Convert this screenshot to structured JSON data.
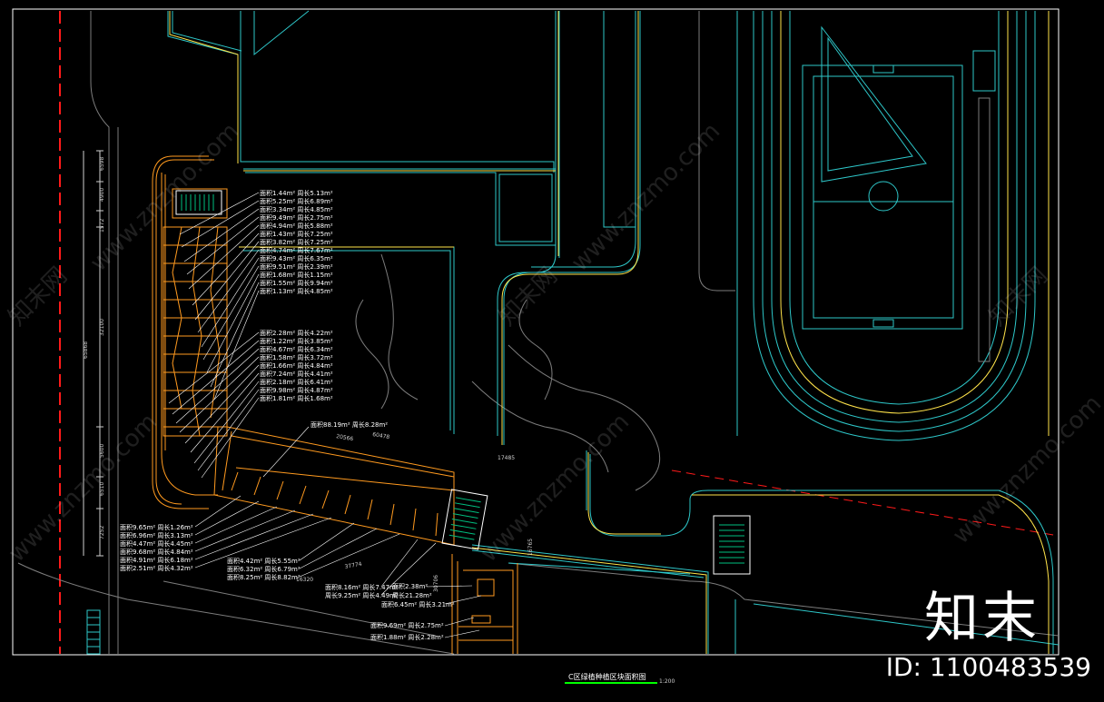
{
  "drawing": {
    "title": "C区绿植种植区块面积图",
    "scale": "1:200"
  },
  "labels_group_a": [
    "面积1.44m² 周长5.13m²",
    "面积5.25m² 周长6.89m²",
    "面积3.34m² 周长4.85m²",
    "面积9.49m² 周长2.75m²",
    "面积4.94m² 周长5.88m²",
    "面积1.43m² 周长7.25m²",
    "面积3.82m² 周长7.25m²",
    "面积4.74m² 周长7.67m²",
    "面积9.43m² 周长6.35m²",
    "面积9.51m² 周长2.39m²",
    "面积1.68m² 周长1.15m²",
    "面积1.55m² 周长9.94m²",
    "面积1.13m² 周长4.85m²"
  ],
  "labels_group_b": [
    "面积2.28m² 周长4.22m²",
    "面积1.22m² 周长3.85m²",
    "面积4.67m² 周长6.34m²",
    "面积1.58m² 周长3.72m²",
    "面积1.66m² 周长4.84m²",
    "面积7.24m² 周长4.41m²",
    "面积2.18m² 周长6.41m²",
    "面积9.98m² 周长4.87m²",
    "面积1.81m² 周长1.68m²"
  ],
  "label_main": "面积88.19m² 周长8.28m²",
  "labels_group_c": [
    "面积9.65m² 周长1.26m²",
    "面积6.96m² 周长3.13m²",
    "面积4.47m² 周长4.45m²",
    "面积9.68m² 周长4.84m²",
    "面积4.91m² 周长6.18m²",
    "面积2.51m² 周长4.32m²"
  ],
  "labels_group_d": [
    "面积4.42m² 周长5.55m²",
    "面积6.32m² 周长6.79m²",
    "面积8.25m² 周长8.82m²"
  ],
  "labels_group_e": [
    "面积8.16m² 周长7.47m²",
    "周长9.25m² 周长4.49m²"
  ],
  "labels_group_f": [
    "面积2.38m²",
    "周长21.28m²",
    "面积6.45m² 周长3.21m²"
  ],
  "labels_group_g": [
    "面积9.69m² 周长2.75m²",
    "面积1.88m² 周长2.28m²"
  ],
  "dimensions": {
    "left_total": "65868",
    "left_1": "6598",
    "left_2": "4900",
    "left_3": "1572",
    "left_4": "32100",
    "left_5": "5600",
    "left_6": "6510",
    "left_7": "7252",
    "mid_1": "20566",
    "mid_2": "60478",
    "mid_3": "17485",
    "mid_4": "37774",
    "mid_5": "16320",
    "mid_6": "30706",
    "mid_7": "16765"
  },
  "watermark": {
    "text": "www.znzmo.com",
    "cn": "知末网"
  },
  "brand": "知末",
  "id_text": "ID: 1100483539",
  "colors": {
    "background": "#000000",
    "frame": "#ffffff",
    "orange": "#ff9a1f",
    "cyan": "#2ec7c9",
    "yellow": "#ffe34a",
    "gray": "#7d7d7d",
    "red": "#ff1a1a",
    "green": "#00ff00"
  }
}
